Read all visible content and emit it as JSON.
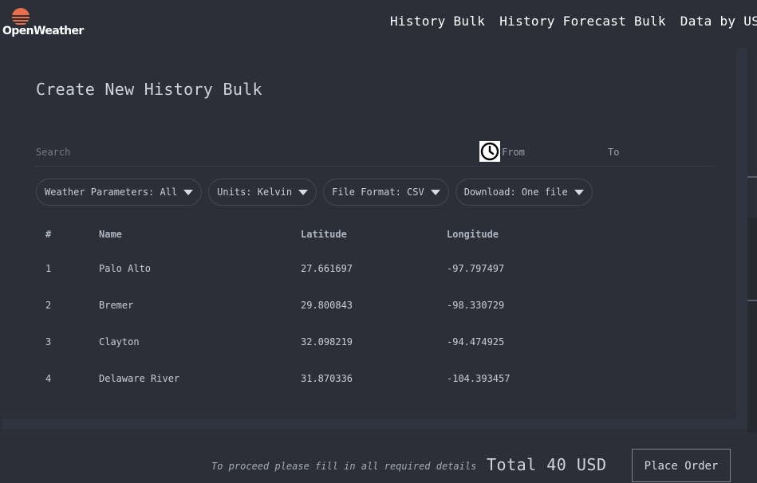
{
  "brand": {
    "name": "OpenWeather",
    "logo_color": "#eb6e4b"
  },
  "nav": {
    "items": [
      "History Bulk",
      "History Forecast Bulk",
      "Data by US"
    ]
  },
  "page": {
    "title": "Create New History Bulk"
  },
  "search": {
    "placeholder": "Search",
    "from_placeholder": "From",
    "to_placeholder": "To"
  },
  "filters": [
    {
      "label": "Weather Parameters: All"
    },
    {
      "label": "Units: Kelvin"
    },
    {
      "label": "File Format: CSV"
    },
    {
      "label": "Download: One file"
    }
  ],
  "table": {
    "headers": [
      "#",
      "Name",
      "Latitude",
      "Longitude"
    ],
    "rows": [
      [
        "1",
        "Palo Alto",
        "27.661697",
        "-97.797497"
      ],
      [
        "2",
        "Bremer",
        "29.800843",
        "-98.330729"
      ],
      [
        "3",
        "Clayton",
        "32.098219",
        "-94.474925"
      ],
      [
        "4",
        "Delaware River",
        "31.870336",
        "-104.393457"
      ]
    ]
  },
  "footer": {
    "note": "To proceed please fill in all required details",
    "total": "Total 40 USD",
    "place_order": "Place Order"
  },
  "icons": {
    "clock": "clock-icon",
    "caret": "caret-down-icon"
  }
}
